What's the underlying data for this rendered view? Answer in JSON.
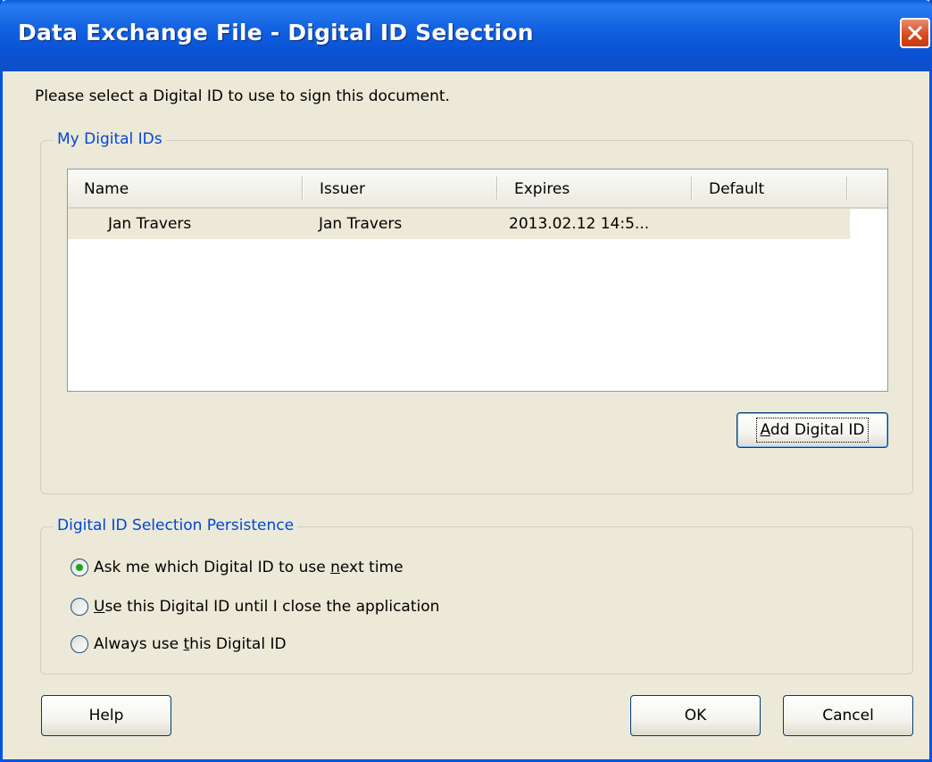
{
  "window": {
    "title": "Data Exchange File - Digital ID Selection"
  },
  "prompt": "Please select a Digital ID to use to sign this document.",
  "my_ids": {
    "legend": "My Digital IDs",
    "columns": [
      "Name",
      "Issuer",
      "Expires",
      "Default"
    ],
    "rows": [
      {
        "name": "Jan Travers",
        "issuer": "Jan Travers",
        "expires": "2013.02.12 14:5...",
        "default": ""
      }
    ],
    "add_button": {
      "pre": "",
      "mnemonic": "A",
      "post": "dd Digital ID"
    }
  },
  "persistence": {
    "legend": "Digital ID Selection Persistence",
    "options": [
      {
        "pre": "Ask me which Digital ID to use ",
        "mnemonic": "n",
        "post": "ext time",
        "selected": true
      },
      {
        "pre": "",
        "mnemonic": "U",
        "post": "se this Digital ID until I close the application",
        "selected": false
      },
      {
        "pre": "Always use ",
        "mnemonic": "t",
        "post": "his Digital ID",
        "selected": false
      }
    ]
  },
  "buttons": {
    "help": "Help",
    "ok": "OK",
    "cancel": "Cancel"
  },
  "colors": {
    "titlebar": "#0a53d6",
    "legend_text": "#0046d5",
    "dialog_bg": "#ece9d8",
    "close_button": "#d7481c"
  }
}
